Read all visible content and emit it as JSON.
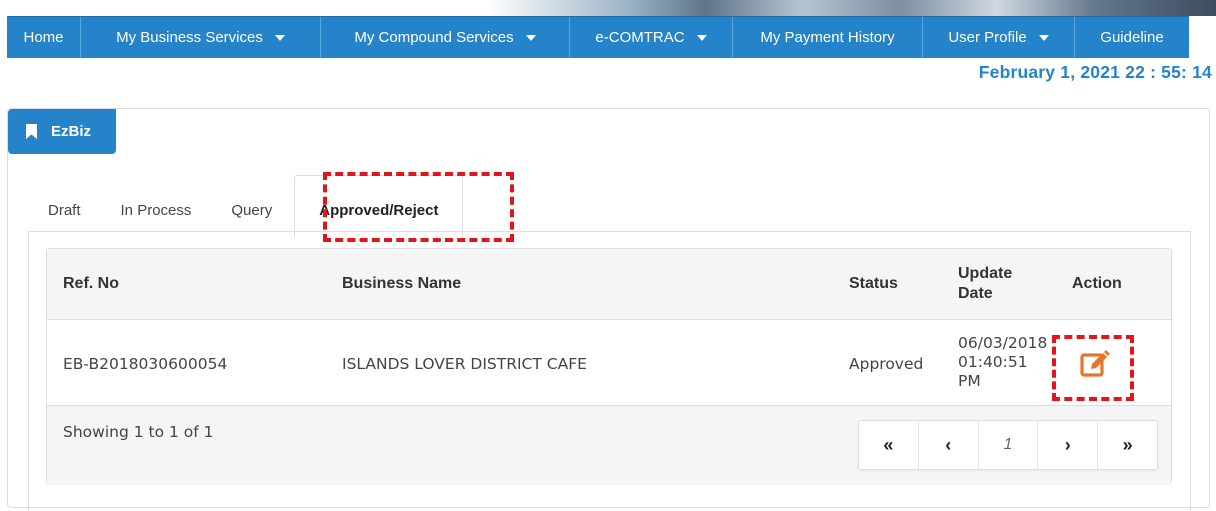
{
  "nav": {
    "home": "Home",
    "business": "My Business Services",
    "compound": "My Compound Services",
    "ecomtrac": "e-COMTRAC",
    "payment": "My Payment History",
    "profile": "User Profile",
    "guideline": "Guideline"
  },
  "datetime": "February 1, 2021 22 : 55: 14",
  "panel": {
    "title": "EzBiz"
  },
  "tabs": [
    "Draft",
    "In Process",
    "Query",
    "Approved/Reject"
  ],
  "active_tab": "Approved/Reject",
  "table": {
    "headers": {
      "ref": "Ref. No",
      "name": "Business Name",
      "status": "Status",
      "update1": "Update",
      "update2": "Date",
      "action": "Action"
    },
    "rows": [
      {
        "ref": "EB-B2018030600054",
        "name": "ISLANDS LOVER DISTRICT CAFE",
        "status": "Approved",
        "date": "06/03/2018",
        "time": "01:40:51",
        "ampm": "PM"
      }
    ],
    "summary": "Showing 1 to 1 of 1"
  },
  "pagination": {
    "first": "«",
    "prev": "‹",
    "page": "1",
    "next": "›",
    "last": "»"
  },
  "colors": {
    "primary": "#2483c9",
    "edit_icon": "#e8742c",
    "highlight": "#e0161b"
  }
}
